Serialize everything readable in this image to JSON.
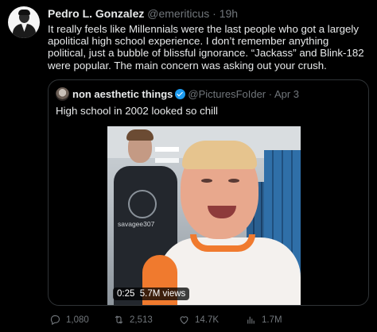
{
  "tweet": {
    "author_name": "Pedro L. Gonzalez",
    "meta": "@emeriticus · 19h",
    "text": "It really feels like Millennials were the last people who got a largely apolitical high school experience. I don’t remember anything political, just a bubble of blissful ignorance. “Jackass” and Blink-182 were popular. The main concern was asking out your crush."
  },
  "quote": {
    "author_name": "non aesthetic things",
    "meta": "@PicturesFoIder · Apr 3",
    "text": "High school in 2002 looked so chill",
    "video": {
      "overlay_text": "savagee307",
      "duration": "0:25",
      "views": "5.7M views"
    }
  },
  "actions": {
    "replies": "1,080",
    "retweets": "2,513",
    "likes": "14.7K",
    "views": "1.7M"
  },
  "colors": {
    "accent": "#1d9bf0",
    "muted": "#71767b",
    "text": "#e7e9ea",
    "background": "#000000"
  }
}
